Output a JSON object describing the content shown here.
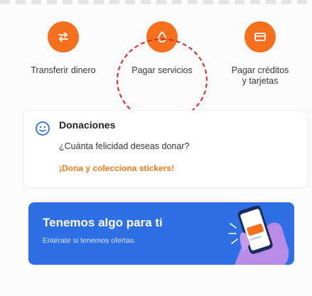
{
  "actions": [
    {
      "label": "Transferir dinero",
      "icon": "transfer-icon"
    },
    {
      "label": "Pagar servicios",
      "icon": "drop-icon"
    },
    {
      "label": "Pagar créditos\ny tarjetas",
      "icon": "card-icon"
    }
  ],
  "donation": {
    "title": "Donaciones",
    "question": "¿Cuánta felicidad deseas donar?",
    "cta": "¡Dona y colecciona stickers!",
    "icon": "smile-icon"
  },
  "promo": {
    "headline": "Tenemos algo para ti",
    "subtitle": "Entérate si tenemos ofertas",
    "art_icon": "phone-hand-icon"
  },
  "colors": {
    "accent": "#f5701c",
    "promo_bg": "#2f6fe6",
    "highlight": "#d8262e",
    "cta_text": "#f07a14"
  }
}
